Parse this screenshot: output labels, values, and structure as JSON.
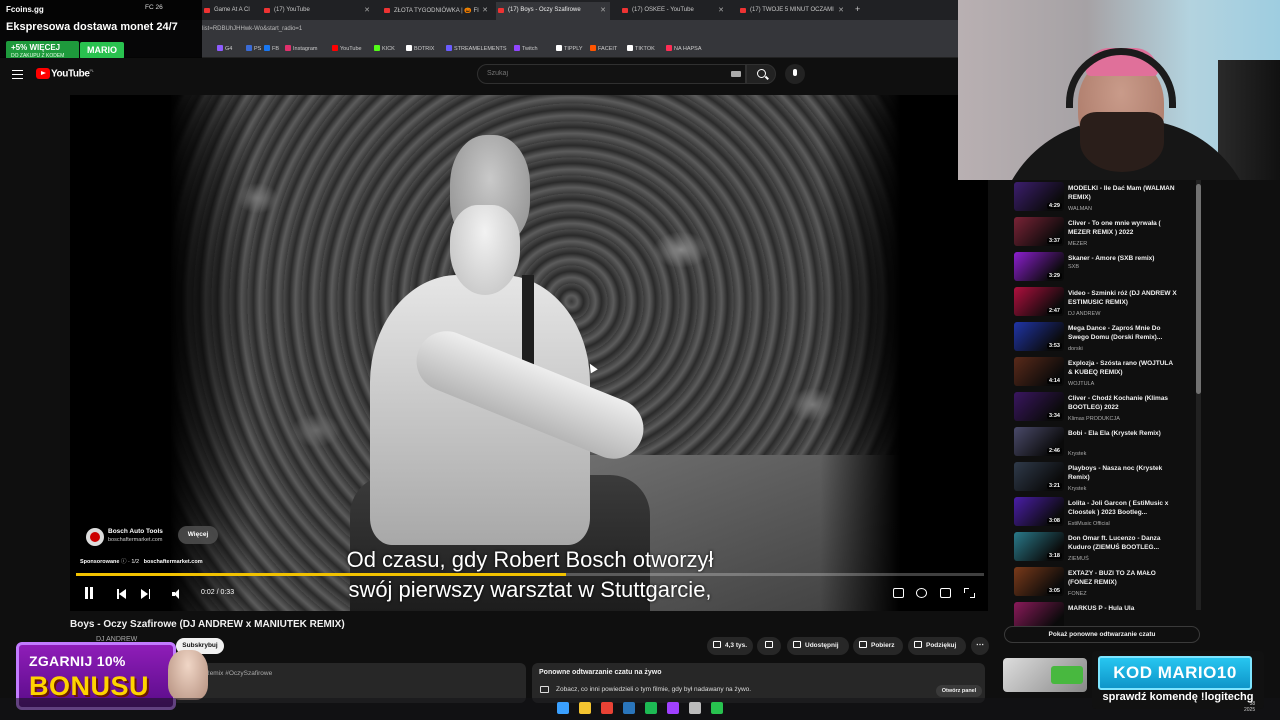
{
  "browser": {
    "tabs": [
      {
        "label": "Game At A Cl"
      },
      {
        "label": "(17) YouTube"
      },
      {
        "label": "ZŁOTA TYGODNIÓWKA | 🎃 FI"
      },
      {
        "label": "(17) Boys - Oczy Szafirowe"
      },
      {
        "label": "(17) OSKEE - YouTube"
      },
      {
        "label": "(17) TWOJE 5 MINUT OCZAMI"
      }
    ],
    "new_tab": "+",
    "url": "list=RDBUhJHHwk-Wo&start_radio=1",
    "bookmarks": [
      {
        "label": "G4",
        "color": "#8e5cff"
      },
      {
        "label": "PS",
        "color": "#3a6bd6"
      },
      {
        "label": "FB",
        "color": "#1877f2"
      },
      {
        "label": "Instagram",
        "color": "#e1306c"
      },
      {
        "label": "YouTube",
        "color": "#ff0000"
      },
      {
        "label": "KICK",
        "color": "#53fc18"
      },
      {
        "label": "BOTRIX",
        "color": "#ffffff"
      },
      {
        "label": "STREAMELEMENTS",
        "color": "#6a5cff"
      },
      {
        "label": "Twitch",
        "color": "#9146ff"
      },
      {
        "label": "TIPPLY",
        "color": "#ffffff"
      },
      {
        "label": "FACEIT",
        "color": "#ff5500"
      },
      {
        "label": "TIKTOK",
        "color": "#ffffff"
      },
      {
        "label": "NA HAPSA",
        "color": "#ff2d55"
      }
    ]
  },
  "promo": {
    "logo": "Fcoins.gg",
    "status": "FC 26",
    "headline": "Ekspresowa dostawa monet 24/7",
    "bonus": "+5% WIĘCEJ",
    "bonus_sub": "DO ZAKUPU Z KODEM",
    "code": "MARIO"
  },
  "youtube": {
    "logo": "YouTube",
    "logo_suffix": "PL",
    "search_placeholder": "Szukaj"
  },
  "player": {
    "ad_name": "Bosch Auto Tools",
    "ad_domain": "boschaftermarket.com",
    "ad_more": "Więcej",
    "sponsored": "Sponsorowane",
    "ad_count": "· 1/2",
    "sponsored_domain": "boschaftermarket.com",
    "subtitle_line1": "Od czasu, gdy Robert Bosch otworzył",
    "subtitle_line2": "swój pierwszy warsztat w Stuttgarcie,",
    "time": "0:02 / 0:33",
    "progress": 0.54
  },
  "video": {
    "title": "Boys - Oczy Szafirowe (DJ ANDREW x MANIUTEK REMIX)",
    "channel": "DJ ANDREW",
    "subscribe": "Subskrybuj",
    "likes": "4,3 tys.",
    "share": "Udostępnij",
    "download": "Pobierz",
    "thanks": "Podziękuj",
    "more": "⋯",
    "hashtag": "Remix #OczySzafirowe"
  },
  "live_chat": {
    "title": "Ponowne odtwarzanie czatu na żywo",
    "description": "Zobacz, co inni powiedzieli o tym filmie, gdy był nadawany na żywo.",
    "open_button": "Otwórz panel"
  },
  "sidebar": {
    "items": [
      {
        "title": "MODELKI - Ile Dać Mam (WALMAN REMIX)",
        "channel": "WALMAN",
        "duration": "4:29",
        "color": "#3c1e6e"
      },
      {
        "title": "Cliver - To one mnie wyrwała ( MEZER REMIX ) 2022",
        "channel": "MEZER",
        "duration": "3:37",
        "color": "#7a2336"
      },
      {
        "title": "Skaner - Amore (SXB remix)",
        "channel": "SXB",
        "duration": "3:29",
        "color": "#8d1fd0"
      },
      {
        "title": "Video - Szminki róż (DJ ANDREW X ESTIMUSIC REMIX)",
        "channel": "DJ ANDREW",
        "duration": "2:47",
        "color": "#b0103e"
      },
      {
        "title": "Mega Dance - Zaproś Mnie Do Swego Domu (Dorski Remix)...",
        "channel": "dorski",
        "duration": "3:53",
        "color": "#2035a8"
      },
      {
        "title": "Explozja - Szósta rano (WOJTULA & KUBEQ REMIX)",
        "channel": "WOJTULA",
        "duration": "4:14",
        "color": "#5a2a1a"
      },
      {
        "title": "Cliver - Chodź Kochanie (Klimas BOOTLEG) 2022",
        "channel": "Klimas PRODUKCJA",
        "duration": "3:34",
        "color": "#3a1660"
      },
      {
        "title": "Bobi - Ela Ela (Krystek Remix)",
        "channel": "Krystek",
        "duration": "2:46",
        "color": "#4a4a6a"
      },
      {
        "title": "Playboys - Nasza noc (Krystek Remix)",
        "channel": "Krystek",
        "duration": "3:21",
        "color": "#2f3a4a"
      },
      {
        "title": "Lolita - Joli Garcon ( EstiMusic x Cloostek ) 2023 Bootleg...",
        "channel": "EstiMusic Official",
        "duration": "3:08",
        "color": "#4a1ea8"
      },
      {
        "title": "Don Omar ft. Lucenzo - Danza Kuduro (ZIEMUŚ BOOTLEG...",
        "channel": "ZIEMUŚ",
        "duration": "3:18",
        "color": "#2a7a8a"
      },
      {
        "title": "EXTAZY - BUZI TO ZA MAŁO (FONEZ REMIX)",
        "channel": "FONEZ",
        "duration": "3:05",
        "color": "#7a3a1a"
      },
      {
        "title": "MARKUS P - Hula Ula",
        "channel": "",
        "duration": "",
        "color": "#8a1a5a"
      }
    ],
    "replay_button": "Pokaż ponowne odtwarzanie czatu"
  },
  "overlays": {
    "bonus_line1": "ZGARNIJ 10%",
    "bonus_line2": "BONUSU",
    "kod": "KOD MARIO10",
    "kod_sub": "sprawdź komendę !logitechg",
    "clock_time": "38",
    "clock_date": "2025"
  },
  "taskbar": {
    "icons": [
      {
        "name": "windows-start-icon",
        "color": "#3aa0ff"
      },
      {
        "name": "file-explorer-icon",
        "color": "#f4c430"
      },
      {
        "name": "chrome-icon",
        "color": "#e94235"
      },
      {
        "name": "steam-icon",
        "color": "#2a75bb"
      },
      {
        "name": "spotify-icon",
        "color": "#1db954"
      },
      {
        "name": "messenger-icon",
        "color": "#a040ff"
      },
      {
        "name": "obs-icon",
        "color": "#bbbbbb"
      },
      {
        "name": "app-icon",
        "color": "#28c24f"
      }
    ]
  }
}
